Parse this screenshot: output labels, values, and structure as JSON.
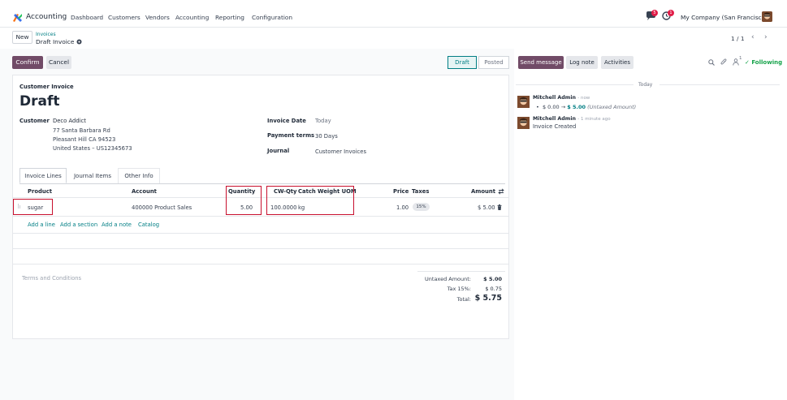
{
  "navbar": {
    "app_name": "Accounting",
    "menu": [
      "Dashboard",
      "Customers",
      "Vendors",
      "Accounting",
      "Reporting",
      "Configuration"
    ],
    "chat_badge": "5",
    "activity_badge": "1",
    "company": "My Company (San Francisco)"
  },
  "control": {
    "new_label": "New",
    "breadcrumb_parent": "Invoices",
    "breadcrumb_current": "Draft Invoice",
    "pager": "1 / 1",
    "confirm_label": "Confirm",
    "cancel_label": "Cancel",
    "status_draft": "Draft",
    "status_posted": "Posted"
  },
  "invoice": {
    "type_label": "Customer Invoice",
    "state_title": "Draft",
    "customer_label": "Customer",
    "customer_name": "Deco Addict",
    "address_line1": "77 Santa Barbara Rd",
    "address_line2": "Pleasant Hill CA 94523",
    "address_line3": "United States – US12345673",
    "invoice_date_label": "Invoice Date",
    "invoice_date_value": "Today",
    "payment_terms_label": "Payment terms",
    "payment_terms_value": "30 Days",
    "journal_label": "Journal",
    "journal_value": "Customer Invoices"
  },
  "tabs": [
    "Invoice Lines",
    "Journal Items",
    "Other Info"
  ],
  "table": {
    "headers": {
      "product": "Product",
      "account": "Account",
      "quantity": "Quantity",
      "cw_qty": "CW-Qty",
      "catch_weight_uom": "Catch Weight UOM",
      "price": "Price",
      "taxes": "Taxes",
      "amount": "Amount"
    },
    "row": {
      "product": "sugar",
      "account": "400000 Product Sales",
      "quantity": "5.00",
      "cw_qty": "100.0000",
      "uom": "kg",
      "price": "1.00",
      "tax": "15%",
      "amount": "$ 5.00"
    },
    "add_line": "Add a line",
    "add_section": "Add a section",
    "add_note": "Add a note",
    "catalog": "Catalog"
  },
  "footer": {
    "terms_placeholder": "Terms and Conditions",
    "untaxed_label": "Untaxed Amount:",
    "untaxed_value": "$ 5.00",
    "tax_label": "Tax 15%:",
    "tax_value": "$ 0.75",
    "total_label": "Total:",
    "total_value": "$ 5.75"
  },
  "chatter": {
    "send_message": "Send message",
    "log_note": "Log note",
    "activities": "Activities",
    "followers_count": "1",
    "following": "Following",
    "day_separator": "Today",
    "messages": [
      {
        "author": "Mitchell Admin",
        "time": "- now",
        "change_old": "$ 0.00",
        "change_new": "$ 5.00",
        "change_field": "(Untaxed Amount)"
      },
      {
        "author": "Mitchell Admin",
        "time": "- 1 minute ago",
        "body": "Invoice Created"
      }
    ]
  },
  "colors": {
    "brand": "#714b67",
    "accent": "#017e84",
    "highlight_box": "#c8102e",
    "following": "#16a34a"
  }
}
